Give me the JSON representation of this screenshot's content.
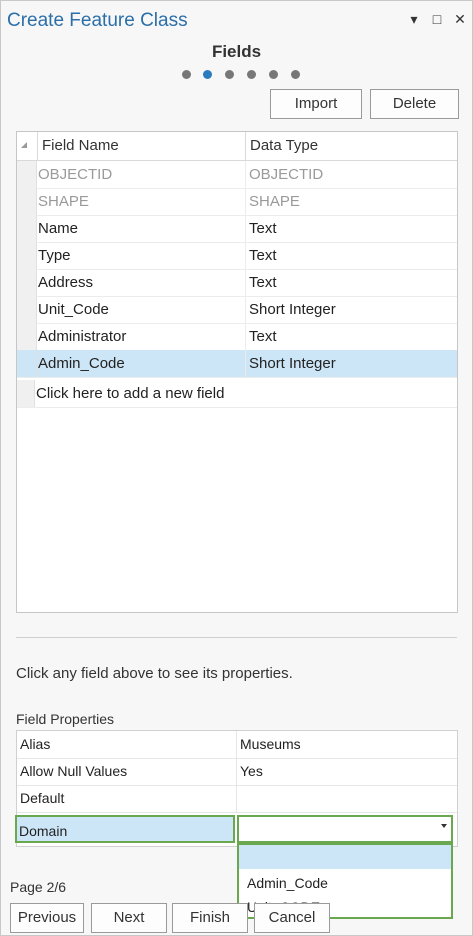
{
  "window": {
    "title": "Create Feature Class",
    "controls": {
      "menu": "▾",
      "maximize": "□",
      "close": "✕"
    }
  },
  "step": {
    "title": "Fields",
    "dots_total": 6,
    "active_index": 1
  },
  "toolbar": {
    "import_label": "Import",
    "delete_label": "Delete"
  },
  "fields_grid": {
    "columns": [
      "Field Name",
      "Data Type"
    ],
    "rows": [
      {
        "name": "OBJECTID",
        "type": "OBJECTID"
      },
      {
        "name": "SHAPE",
        "type": "SHAPE"
      },
      {
        "name": "Name",
        "type": "Text"
      },
      {
        "name": "Type",
        "type": "Text"
      },
      {
        "name": "Address",
        "type": "Text"
      },
      {
        "name": "Unit_Code",
        "type": "Short Integer"
      },
      {
        "name": "Administrator",
        "type": "Text"
      },
      {
        "name": "Admin_Code",
        "type": "Short Integer"
      }
    ],
    "add_row_label": "Click here to add a new field"
  },
  "hint": "Click any field above to see its properties.",
  "field_properties": {
    "label": "Field Properties",
    "rows": [
      {
        "key": "Alias",
        "value": "Museums"
      },
      {
        "key": "Allow Null Values",
        "value": "Yes"
      },
      {
        "key": "Default",
        "value": ""
      }
    ],
    "domain_label": "Domain",
    "domain_value": "",
    "domain_options": [
      "",
      "Admin_Code",
      "Unit_CODE"
    ]
  },
  "footer": {
    "page": "Page 2/6",
    "previous_label": "Previous",
    "next_label": "Next",
    "finish_label": "Finish",
    "cancel_label": "Cancel"
  },
  "colors": {
    "accent": "#2b6fa8",
    "selection": "#cce6f7",
    "highlight_border": "#6aa84f"
  }
}
